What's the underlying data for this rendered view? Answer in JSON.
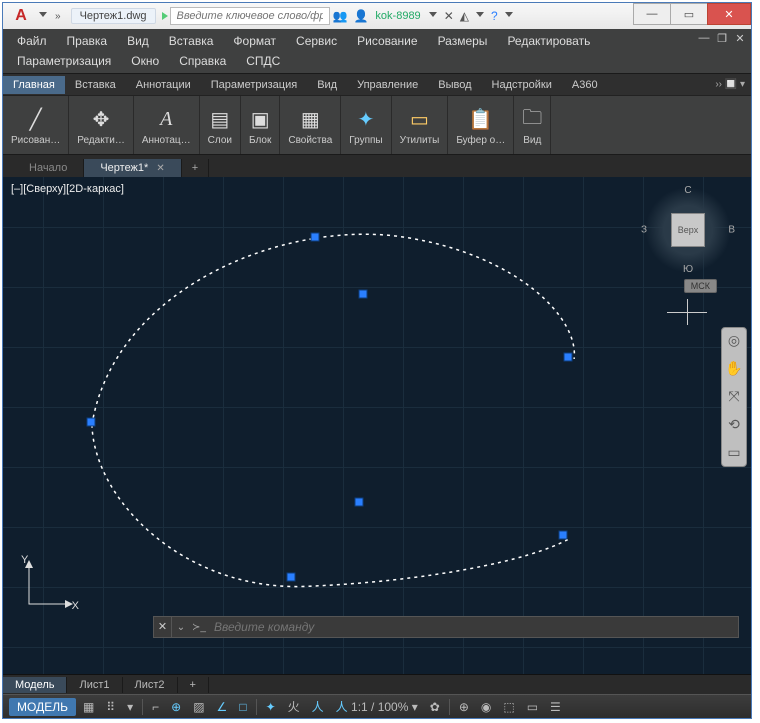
{
  "titlebar": {
    "logo_letter": "A",
    "doc_name": "Чертеж1.dwg",
    "search_placeholder": "Введите ключевое слово/фразу",
    "user": "kok-8989"
  },
  "menu": [
    "Файл",
    "Правка",
    "Вид",
    "Вставка",
    "Формат",
    "Сервис",
    "Рисование",
    "Размеры",
    "Редактировать",
    "Параметризация",
    "Окно",
    "Справка",
    "СПДС"
  ],
  "ribtabs": [
    "Главная",
    "Вставка",
    "Аннотации",
    "Параметризация",
    "Вид",
    "Управление",
    "Вывод",
    "Надстройки",
    "A360"
  ],
  "ribbon": [
    {
      "label": "Рисован…",
      "icon": "╱"
    },
    {
      "label": "Редакти…",
      "icon": "✥"
    },
    {
      "label": "Аннотац…",
      "icon": "A"
    },
    {
      "label": "Слои",
      "icon": "▤"
    },
    {
      "label": "Блок",
      "icon": "▣"
    },
    {
      "label": "Свойства",
      "icon": "▒"
    },
    {
      "label": "Группы",
      "icon": "✦"
    },
    {
      "label": "Утилиты",
      "icon": "📏"
    },
    {
      "label": "Буфер о…",
      "icon": "📋"
    },
    {
      "label": "Вид",
      "icon": "🗀"
    }
  ],
  "doctabs": {
    "start": "Начало",
    "active": "Чертеж1*"
  },
  "canvas": {
    "viewlabel": "[–][Сверху][2D-каркас]",
    "viewcube": {
      "face": "Верх",
      "n": "С",
      "s": "Ю",
      "e": "В",
      "w": "З"
    },
    "mck": "МСК",
    "y": "Y",
    "x": "X"
  },
  "cmd": {
    "placeholder": "Введите команду"
  },
  "layouts": [
    "Модель",
    "Лист1",
    "Лист2"
  ],
  "status": {
    "model": "МОДЕЛЬ",
    "zoom": "1:1 / 100%"
  }
}
